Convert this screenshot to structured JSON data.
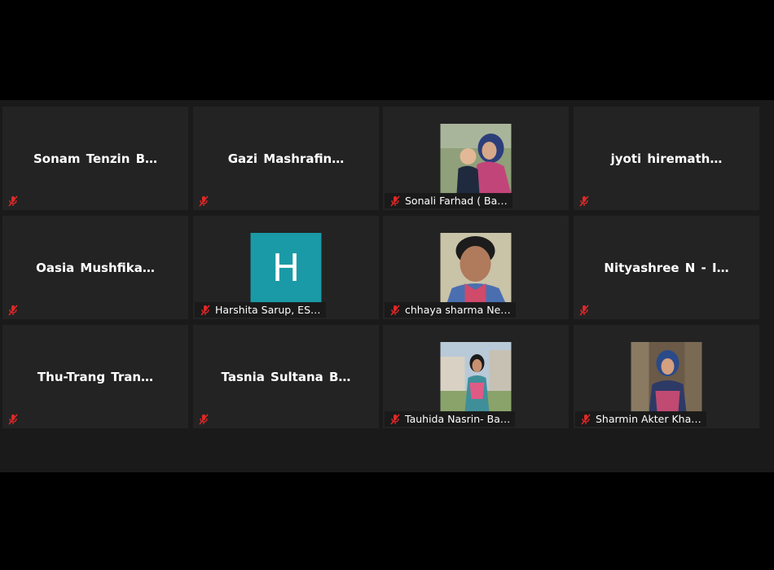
{
  "meeting": {
    "participants": [
      {
        "name": "Sonam Tenzin B…",
        "has_photo": false,
        "muted": true
      },
      {
        "name": "Gazi Mashrafin…",
        "has_photo": false,
        "muted": true
      },
      {
        "name": "Sonali Farhad ( Ba…",
        "has_photo": true,
        "muted": true
      },
      {
        "name": "jyoti hiremath…",
        "has_photo": false,
        "muted": true
      },
      {
        "name": "Oasia Mushfika…",
        "has_photo": false,
        "muted": true
      },
      {
        "name": "Harshita Sarup, ES…",
        "has_photo": true,
        "avatar_letter": "H",
        "muted": true
      },
      {
        "name": "chhaya sharma Ne…",
        "has_photo": true,
        "muted": true
      },
      {
        "name": "Nityashree N - I…",
        "has_photo": false,
        "muted": true
      },
      {
        "name": "Thu-Trang Tran…",
        "has_photo": false,
        "muted": true
      },
      {
        "name": "Tasnia Sultana B…",
        "has_photo": false,
        "muted": true
      },
      {
        "name": "Tauhida Nasrin- Ba…",
        "has_photo": true,
        "muted": true
      },
      {
        "name": "Sharmin Akter Kha…",
        "has_photo": true,
        "muted": true
      }
    ]
  },
  "colors": {
    "background": "#000000",
    "gallery": "#1a1a1a",
    "tile": "#232323",
    "mute_red": "#e02828",
    "avatar_teal": "#1a9aa6"
  },
  "icons": {
    "mute": "microphone-muted-icon"
  }
}
